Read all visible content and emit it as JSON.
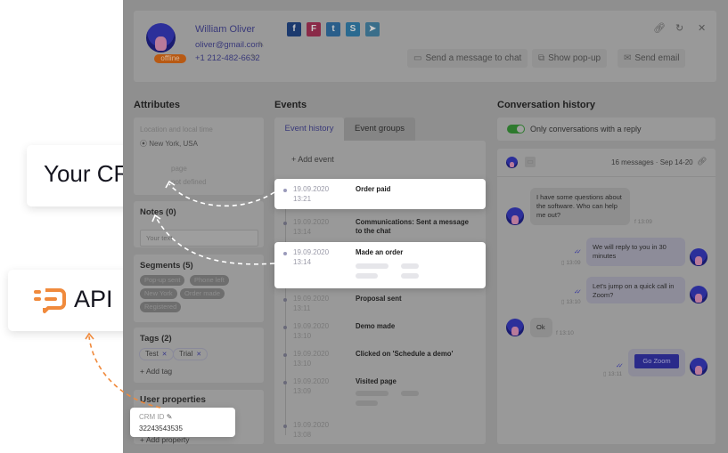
{
  "header": {
    "user_name": "William Oliver",
    "email": "oliver@gmail.com",
    "phone": "+1 212-482-6632",
    "status": "offline",
    "social": [
      {
        "name": "facebook",
        "glyph": "f",
        "color": "#1c3a6e"
      },
      {
        "name": "foursquare",
        "glyph": "F",
        "color": "#8a2a48"
      },
      {
        "name": "twitter",
        "glyph": "t",
        "color": "#2a5e8a"
      },
      {
        "name": "skype",
        "glyph": "S",
        "color": "#2a6a90"
      },
      {
        "name": "telegram",
        "glyph": "➤",
        "color": "#3a6e8a"
      }
    ],
    "buttons": {
      "send_chat": "Send a message to chat",
      "show_popup": "Show pop-up",
      "send_email": "Send email"
    }
  },
  "attributes": {
    "title": "Attributes",
    "location_label": "Location and local time",
    "location_value": "New York, USA",
    "page_label": "page",
    "page_value": "not defined",
    "notes_title": "Notes (0)",
    "notes_placeholder": "Your text",
    "segments_title": "Segments (5)",
    "segments": [
      "Pop-up sent",
      "Phone left",
      "New York",
      "Order made",
      "Registered"
    ],
    "tags_title": "Tags (2)",
    "tags": [
      "Test",
      "Trial"
    ],
    "add_tag": "Add tag",
    "user_props_title": "User properties",
    "crm_id_label": "CRM ID",
    "crm_id_value": "32243543535",
    "add_property": "Add property"
  },
  "events": {
    "title": "Events",
    "tabs": [
      "Event history",
      "Event groups"
    ],
    "add_event": "Add event",
    "items": [
      {
        "date": "19.09.2020",
        "time": "13:21",
        "title": "Order paid"
      },
      {
        "date": "19.09.2020",
        "time": "13:14",
        "title": "Communications: Sent a message to the chat"
      },
      {
        "date": "19.09.2020",
        "time": "13:14",
        "title": "Made an order"
      },
      {
        "date": "19.09.2020",
        "time": "13:11",
        "title": "Proposal sent"
      },
      {
        "date": "19.09.2020",
        "time": "13:10",
        "title": "Demo made"
      },
      {
        "date": "19.09.2020",
        "time": "13:10",
        "title": "Clicked on 'Schedule a demo'"
      },
      {
        "date": "19.09.2020",
        "time": "13:09",
        "title": "Visited page"
      },
      {
        "date": "19.09.2020",
        "time": "13:08",
        "title": ""
      }
    ]
  },
  "conversation": {
    "title": "Conversation history",
    "toggle_label": "Only conversations with a reply",
    "toggle_on": true,
    "summary": "16 messages · Sep 14-20",
    "messages": [
      {
        "dir": "in",
        "text": "I have some questions about the software. Who can help me out?",
        "time": "13:09",
        "channel": "f"
      },
      {
        "dir": "out",
        "text": "We will reply to you in 30 minutes",
        "time": "13:09"
      },
      {
        "dir": "out",
        "text": "Let's jump on a quick call in Zoom?",
        "time": "13:10"
      },
      {
        "dir": "in",
        "text": "Ok",
        "time": "13:10",
        "channel": "f"
      },
      {
        "dir": "out",
        "button": "Go Zoom",
        "time": "13:11"
      }
    ]
  },
  "callouts": {
    "crm": "Your CRM",
    "api": "API",
    "api_color": "#f08a3c"
  }
}
